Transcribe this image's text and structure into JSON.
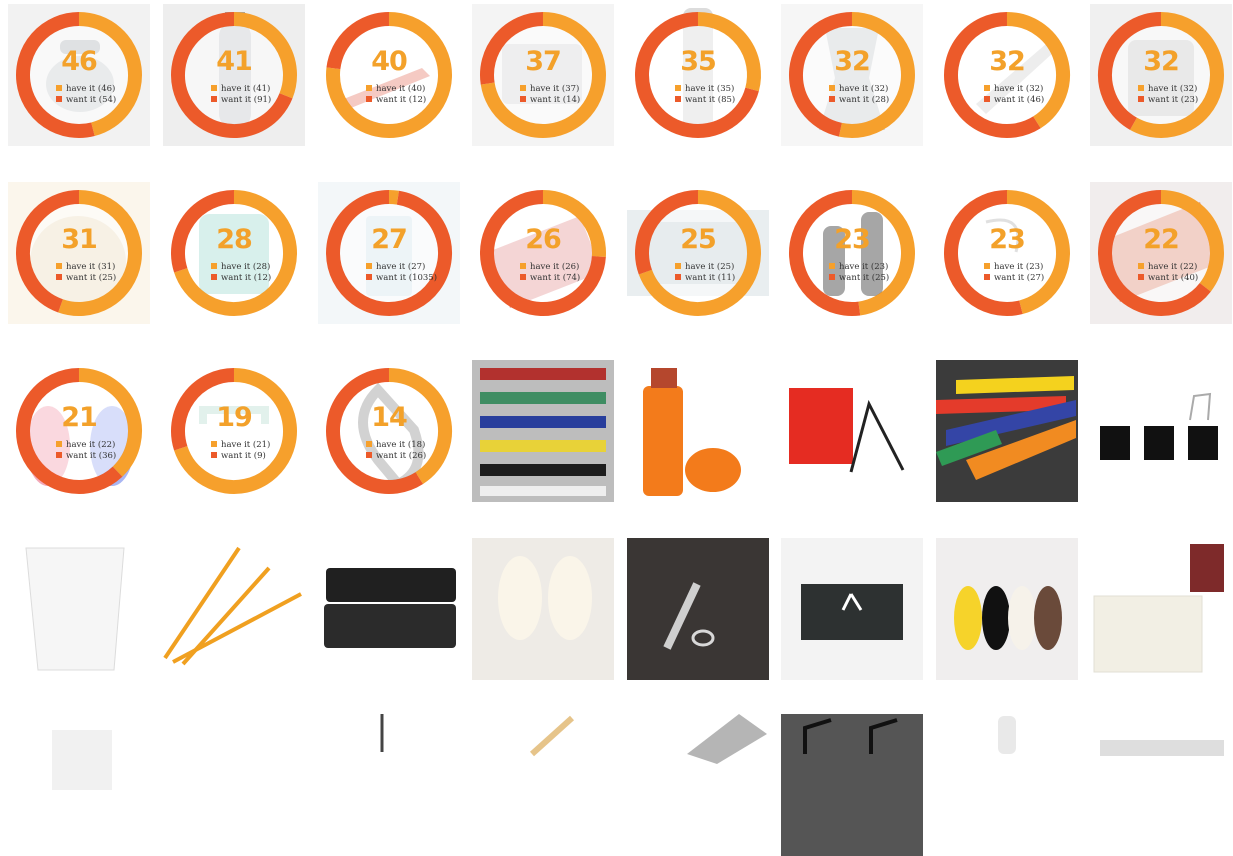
{
  "colors": {
    "have": "#f6a02c",
    "want": "#ec5a2a"
  },
  "rows": [
    [
      {
        "kind": "donut",
        "score": "46",
        "have": 46,
        "want": 54,
        "have_label": "have it (46)",
        "want_label": "want it (54)",
        "photo": "kettle"
      },
      {
        "kind": "donut",
        "score": "41",
        "have": 41,
        "want": 91,
        "have_label": "have it (41)",
        "want_label": "want it (91)",
        "photo": "bottle"
      },
      {
        "kind": "donut",
        "score": "40",
        "have": 40,
        "want": 12,
        "have_label": "have it (40)",
        "want_label": "want it (12)",
        "photo": "knife"
      },
      {
        "kind": "donut",
        "score": "37",
        "have": 37,
        "want": 14,
        "have_label": "have it (37)",
        "want_label": "want it (14)",
        "photo": "scale"
      },
      {
        "kind": "donut",
        "score": "35",
        "have": 35,
        "want": 85,
        "have_label": "have it (35)",
        "want_label": "want it (85)",
        "photo": "grinder"
      },
      {
        "kind": "donut",
        "score": "32",
        "have": 32,
        "want": 28,
        "have_label": "have it (32)",
        "want_label": "want it (28)",
        "photo": "moka-pot"
      },
      {
        "kind": "donut",
        "score": "32",
        "have": 32,
        "want": 46,
        "have_label": "have it (32)",
        "want_label": "want it (46)",
        "photo": "cutter"
      },
      {
        "kind": "donut",
        "score": "32",
        "have": 32,
        "want": 23,
        "have_label": "have it (32)",
        "want_label": "want it (23)",
        "photo": "container"
      }
    ],
    [
      {
        "kind": "donut",
        "score": "31",
        "have": 31,
        "want": 25,
        "have_label": "have it (31)",
        "want_label": "want it (25)",
        "photo": "loofah"
      },
      {
        "kind": "donut",
        "score": "28",
        "have": 28,
        "want": 12,
        "have_label": "have it (28)",
        "want_label": "want it (12)",
        "photo": "mint-cup"
      },
      {
        "kind": "donut",
        "score": "27",
        "have": 27,
        "want": 1035,
        "have_label": "have it (27)",
        "want_label": "want it (1035)",
        "photo": "glass"
      },
      {
        "kind": "donut",
        "score": "26",
        "have": 26,
        "want": 74,
        "have_label": "have it (26)",
        "want_label": "want it (74)",
        "photo": "red-tray"
      },
      {
        "kind": "donut",
        "score": "25",
        "have": 25,
        "want": 11,
        "have_label": "have it (25)",
        "want_label": "want it (11)",
        "photo": "tray-box"
      },
      {
        "kind": "donut",
        "score": "23",
        "have": 23,
        "want": 25,
        "have_label": "have it (23)",
        "want_label": "want it (25)",
        "photo": "pepper-mills"
      },
      {
        "kind": "donut",
        "score": "23",
        "have": 23,
        "want": 27,
        "have_label": "have it (23)",
        "want_label": "want it (27)",
        "photo": "hook"
      },
      {
        "kind": "donut",
        "score": "22",
        "have": 22,
        "want": 40,
        "have_label": "have it (22)",
        "want_label": "want it (40)",
        "photo": "pencil-case"
      }
    ],
    [
      {
        "kind": "donut",
        "score": "21",
        "have": 22,
        "want": 36,
        "have_label": "have it (22)",
        "want_label": "want it (36)",
        "photo": "dolls"
      },
      {
        "kind": "donut",
        "score": "19",
        "have": 21,
        "want": 9,
        "have_label": "have it (21)",
        "want_label": "want it (9)",
        "photo": "clip"
      },
      {
        "kind": "donut",
        "score": "14",
        "have": 18,
        "want": 26,
        "have_label": "have it (18)",
        "want_label": "want it (26)",
        "photo": "carabiner"
      },
      {
        "kind": "photo",
        "photo": "rulers-rack"
      },
      {
        "kind": "photo",
        "photo": "match-tube"
      },
      {
        "kind": "photo",
        "photo": "stand"
      },
      {
        "kind": "photo",
        "photo": "colored-rulers"
      },
      {
        "kind": "photo",
        "photo": "black-cubes"
      }
    ],
    [
      {
        "kind": "photo",
        "photo": "white-cup"
      },
      {
        "kind": "photo",
        "photo": "pencils"
      },
      {
        "kind": "photo",
        "photo": "bento"
      },
      {
        "kind": "photo",
        "photo": "slippers-white"
      },
      {
        "kind": "photo",
        "photo": "pen-ring"
      },
      {
        "kind": "photo",
        "photo": "gift-box"
      },
      {
        "kind": "photo",
        "photo": "slippers-color"
      },
      {
        "kind": "photo",
        "photo": "notebook"
      }
    ],
    [
      {
        "kind": "photo",
        "photo": "row5-1"
      },
      {
        "kind": "photo",
        "photo": "row5-2"
      },
      {
        "kind": "photo",
        "photo": "row5-3"
      },
      {
        "kind": "photo",
        "photo": "row5-4"
      },
      {
        "kind": "photo",
        "photo": "row5-5"
      },
      {
        "kind": "photo",
        "photo": "row5-6"
      },
      {
        "kind": "photo",
        "photo": "row5-7"
      },
      {
        "kind": "photo",
        "photo": "row5-8"
      }
    ]
  ]
}
